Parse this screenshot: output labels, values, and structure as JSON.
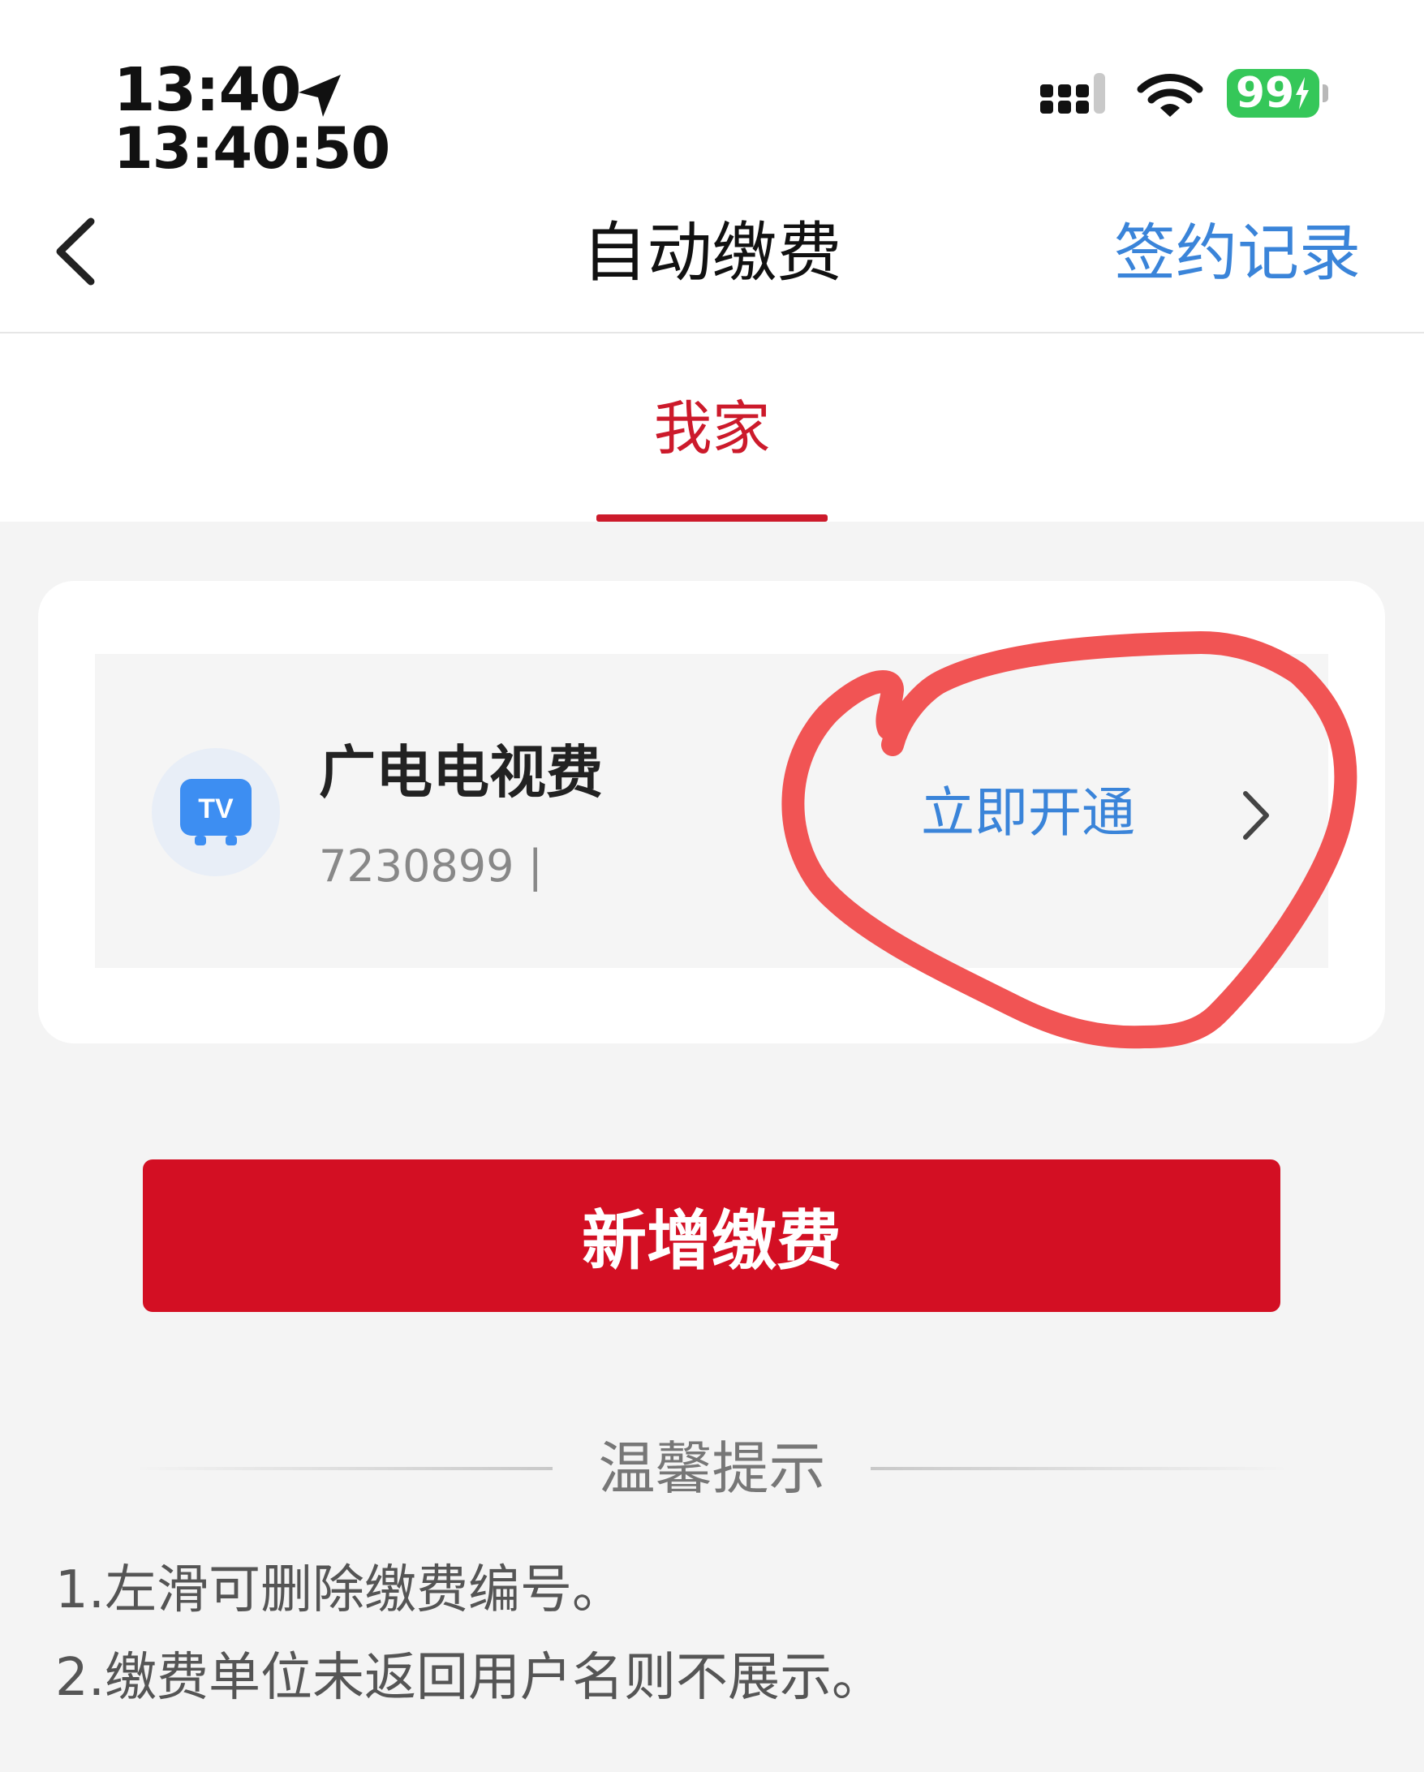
{
  "status_bar": {
    "time": "13:40",
    "time_seconds": "13:40:50",
    "battery": "99"
  },
  "nav": {
    "title": "自动缴费",
    "right_action": "签约记录"
  },
  "tabs": [
    {
      "label": "我家",
      "active": true
    }
  ],
  "payment_item": {
    "name": "广电电视费",
    "number": "7230899 |",
    "icon_text": "TV",
    "action_label": "立即开通"
  },
  "add_button_label": "新增缴费",
  "tips": {
    "title": "温馨提示",
    "items": [
      "1.左滑可删除缴费编号。",
      "2.缴费单位未返回用户名则不展示。"
    ]
  },
  "colors": {
    "accent_red": "#d30f23",
    "tab_red": "#cc1a2b",
    "link_blue": "#3a84d9",
    "battery_green": "#35c759",
    "annotation_red": "#f04b4b"
  }
}
